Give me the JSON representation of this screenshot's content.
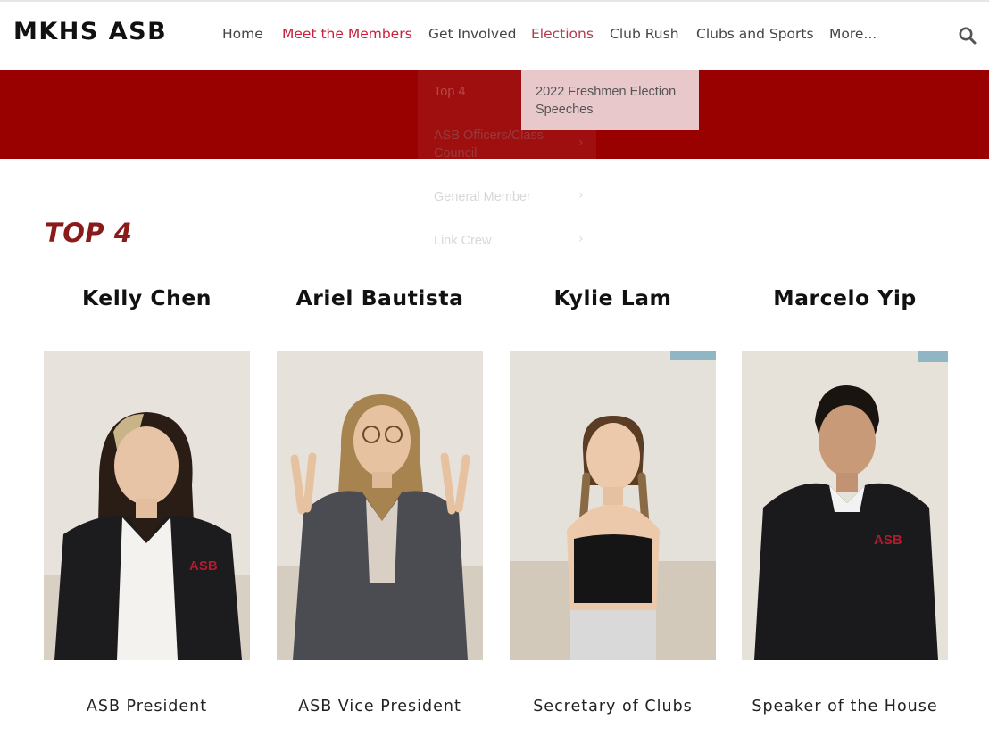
{
  "site": {
    "logo": "MKHS ASB"
  },
  "nav": [
    {
      "label": "Home"
    },
    {
      "label": "Meet the Members"
    },
    {
      "label": "Get Involved"
    },
    {
      "label": "Elections"
    },
    {
      "label": "Club Rush"
    },
    {
      "label": "Clubs and Sports"
    },
    {
      "label": "More..."
    }
  ],
  "dropdown": {
    "items": [
      {
        "label": "Top 4"
      },
      {
        "label": "ASB Officers/Class Council"
      },
      {
        "label": "General Member"
      },
      {
        "label": "Link Crew"
      }
    ],
    "submenu": {
      "label": "2022 Freshmen Election Speeches"
    }
  },
  "section": {
    "title": "TOP 4"
  },
  "members": [
    {
      "name": "Kelly Chen",
      "role": "ASB President",
      "shirt": "#f4f2ee",
      "hair": "#2a1d16"
    },
    {
      "name": "Ariel Bautista",
      "role": "ASB Vice President",
      "shirt": "#d9cfc4",
      "hair": "#a6834f"
    },
    {
      "name": "Kylie Lam",
      "role": "Secretary of Clubs",
      "shirt": "#151515",
      "hair": "#5a3d24"
    },
    {
      "name": "Marcelo Yip",
      "role": "Speaker of the House",
      "shirt": "#f2f2f2",
      "hair": "#1a1410"
    }
  ],
  "colors": {
    "brand": "#990000",
    "accent": "#c8203a",
    "heading": "#8b1a1a",
    "submenu_bg": "#e8c8cb"
  },
  "icons": {
    "search": "search-icon",
    "chevron": "chevron-right-icon"
  }
}
